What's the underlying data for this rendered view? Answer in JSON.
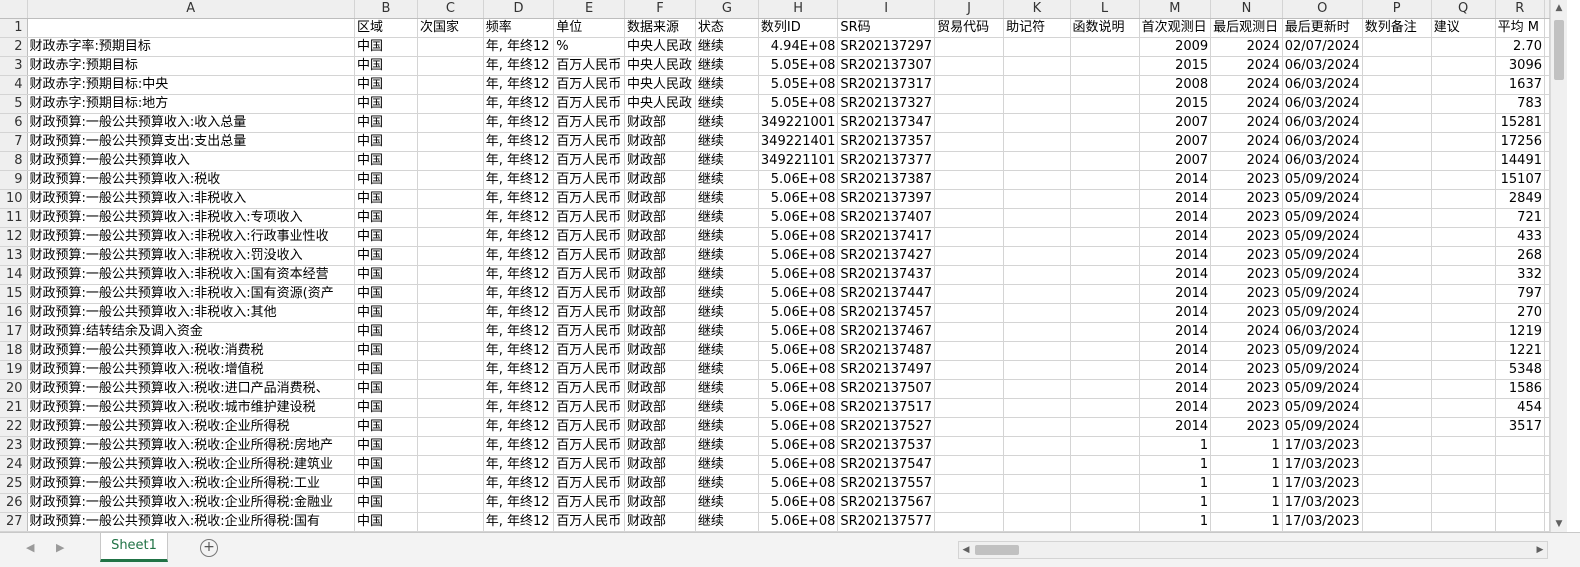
{
  "sheet": {
    "column_letters": [
      "A",
      "B",
      "C",
      "D",
      "E",
      "F",
      "G",
      "H",
      "I",
      "J",
      "K",
      "L",
      "M",
      "N",
      "O",
      "P",
      "Q",
      "R"
    ],
    "header_row_num": "1",
    "headers": [
      "",
      "区域",
      "次国家",
      "频率",
      "单位",
      "数据来源",
      "状态",
      "数列ID",
      "SR码",
      "贸易代码",
      "助记符",
      "函数说明",
      "首次观测日",
      "最后观测日",
      "最后更新时",
      "数列备注",
      "建议",
      "平均 M"
    ],
    "rows": [
      [
        "2",
        "财政赤字率:预期目标",
        "中国",
        "",
        "年, 年终12",
        "%",
        "中央人民政",
        "继续",
        "4.94E+08",
        "SR202137297",
        "",
        "",
        "",
        "2009",
        "2024",
        "02/07/2024",
        "",
        "",
        "2.70"
      ],
      [
        "3",
        "财政赤字:预期目标",
        "中国",
        "",
        "年, 年终12",
        "百万人民币",
        "中央人民政",
        "继续",
        "5.05E+08",
        "SR202137307",
        "",
        "",
        "",
        "2015",
        "2024",
        "06/03/2024",
        "",
        "",
        "3096"
      ],
      [
        "4",
        "财政赤字:预期目标:中央",
        "中国",
        "",
        "年, 年终12",
        "百万人民币",
        "中央人民政",
        "继续",
        "5.05E+08",
        "SR202137317",
        "",
        "",
        "",
        "2008",
        "2024",
        "06/03/2024",
        "",
        "",
        "1637"
      ],
      [
        "5",
        "财政赤字:预期目标:地方",
        "中国",
        "",
        "年, 年终12",
        "百万人民币",
        "中央人民政",
        "继续",
        "5.05E+08",
        "SR202137327",
        "",
        "",
        "",
        "2015",
        "2024",
        "06/03/2024",
        "",
        "",
        "783"
      ],
      [
        "6",
        "财政预算:一般公共预算收入:收入总量",
        "中国",
        "",
        "年, 年终12",
        "百万人民币",
        "财政部",
        "继续",
        "349221001",
        "SR202137347",
        "",
        "",
        "",
        "2007",
        "2024",
        "06/03/2024",
        "",
        "",
        "15281"
      ],
      [
        "7",
        "财政预算:一般公共预算支出:支出总量",
        "中国",
        "",
        "年, 年终12",
        "百万人民币",
        "财政部",
        "继续",
        "349221401",
        "SR202137357",
        "",
        "",
        "",
        "2007",
        "2024",
        "06/03/2024",
        "",
        "",
        "17256"
      ],
      [
        "8",
        "财政预算:一般公共预算收入",
        "中国",
        "",
        "年, 年终12",
        "百万人民币",
        "财政部",
        "继续",
        "349221101",
        "SR202137377",
        "",
        "",
        "",
        "2007",
        "2024",
        "06/03/2024",
        "",
        "",
        "14491"
      ],
      [
        "9",
        "财政预算:一般公共预算收入:税收",
        "中国",
        "",
        "年, 年终12",
        "百万人民币",
        "财政部",
        "继续",
        "5.06E+08",
        "SR202137387",
        "",
        "",
        "",
        "2014",
        "2023",
        "05/09/2024",
        "",
        "",
        "15107"
      ],
      [
        "10",
        "财政预算:一般公共预算收入:非税收入",
        "中国",
        "",
        "年, 年终12",
        "百万人民币",
        "财政部",
        "继续",
        "5.06E+08",
        "SR202137397",
        "",
        "",
        "",
        "2014",
        "2023",
        "05/09/2024",
        "",
        "",
        "2849"
      ],
      [
        "11",
        "财政预算:一般公共预算收入:非税收入:专项收入",
        "中国",
        "",
        "年, 年终12",
        "百万人民币",
        "财政部",
        "继续",
        "5.06E+08",
        "SR202137407",
        "",
        "",
        "",
        "2014",
        "2023",
        "05/09/2024",
        "",
        "",
        "721"
      ],
      [
        "12",
        "财政预算:一般公共预算收入:非税收入:行政事业性收",
        "中国",
        "",
        "年, 年终12",
        "百万人民币",
        "财政部",
        "继续",
        "5.06E+08",
        "SR202137417",
        "",
        "",
        "",
        "2014",
        "2023",
        "05/09/2024",
        "",
        "",
        "433"
      ],
      [
        "13",
        "财政预算:一般公共预算收入:非税收入:罚没收入",
        "中国",
        "",
        "年, 年终12",
        "百万人民币",
        "财政部",
        "继续",
        "5.06E+08",
        "SR202137427",
        "",
        "",
        "",
        "2014",
        "2023",
        "05/09/2024",
        "",
        "",
        "268"
      ],
      [
        "14",
        "财政预算:一般公共预算收入:非税收入:国有资本经营",
        "中国",
        "",
        "年, 年终12",
        "百万人民币",
        "财政部",
        "继续",
        "5.06E+08",
        "SR202137437",
        "",
        "",
        "",
        "2014",
        "2023",
        "05/09/2024",
        "",
        "",
        "332"
      ],
      [
        "15",
        "财政预算:一般公共预算收入:非税收入:国有资源(资产",
        "中国",
        "",
        "年, 年终12",
        "百万人民币",
        "财政部",
        "继续",
        "5.06E+08",
        "SR202137447",
        "",
        "",
        "",
        "2014",
        "2023",
        "05/09/2024",
        "",
        "",
        "797"
      ],
      [
        "16",
        "财政预算:一般公共预算收入:非税收入:其他",
        "中国",
        "",
        "年, 年终12",
        "百万人民币",
        "财政部",
        "继续",
        "5.06E+08",
        "SR202137457",
        "",
        "",
        "",
        "2014",
        "2023",
        "05/09/2024",
        "",
        "",
        "270"
      ],
      [
        "17",
        "财政预算:结转结余及调入资金",
        "中国",
        "",
        "年, 年终12",
        "百万人民币",
        "财政部",
        "继续",
        "5.06E+08",
        "SR202137467",
        "",
        "",
        "",
        "2014",
        "2024",
        "06/03/2024",
        "",
        "",
        "1219"
      ],
      [
        "18",
        "财政预算:一般公共预算收入:税收:消费税",
        "中国",
        "",
        "年, 年终12",
        "百万人民币",
        "财政部",
        "继续",
        "5.06E+08",
        "SR202137487",
        "",
        "",
        "",
        "2014",
        "2023",
        "05/09/2024",
        "",
        "",
        "1221"
      ],
      [
        "19",
        "财政预算:一般公共预算收入:税收:增值税",
        "中国",
        "",
        "年, 年终12",
        "百万人民币",
        "财政部",
        "继续",
        "5.06E+08",
        "SR202137497",
        "",
        "",
        "",
        "2014",
        "2023",
        "05/09/2024",
        "",
        "",
        "5348"
      ],
      [
        "20",
        "财政预算:一般公共预算收入:税收:进口产品消费税、",
        "中国",
        "",
        "年, 年终12",
        "百万人民币",
        "财政部",
        "继续",
        "5.06E+08",
        "SR202137507",
        "",
        "",
        "",
        "2014",
        "2023",
        "05/09/2024",
        "",
        "",
        "1586"
      ],
      [
        "21",
        "财政预算:一般公共预算收入:税收:城市维护建设税",
        "中国",
        "",
        "年, 年终12",
        "百万人民币",
        "财政部",
        "继续",
        "5.06E+08",
        "SR202137517",
        "",
        "",
        "",
        "2014",
        "2023",
        "05/09/2024",
        "",
        "",
        "454"
      ],
      [
        "22",
        "财政预算:一般公共预算收入:税收:企业所得税",
        "中国",
        "",
        "年, 年终12",
        "百万人民币",
        "财政部",
        "继续",
        "5.06E+08",
        "SR202137527",
        "",
        "",
        "",
        "2014",
        "2023",
        "05/09/2024",
        "",
        "",
        "3517"
      ],
      [
        "23",
        "财政预算:一般公共预算收入:税收:企业所得税:房地产",
        "中国",
        "",
        "年, 年终12",
        "百万人民币",
        "财政部",
        "继续",
        "5.06E+08",
        "SR202137537",
        "",
        "",
        "",
        "1",
        "1",
        "17/03/2023",
        "",
        "",
        ""
      ],
      [
        "24",
        "财政预算:一般公共预算收入:税收:企业所得税:建筑业",
        "中国",
        "",
        "年, 年终12",
        "百万人民币",
        "财政部",
        "继续",
        "5.06E+08",
        "SR202137547",
        "",
        "",
        "",
        "1",
        "1",
        "17/03/2023",
        "",
        "",
        ""
      ],
      [
        "25",
        "财政预算:一般公共预算收入:税收:企业所得税:工业",
        "中国",
        "",
        "年, 年终12",
        "百万人民币",
        "财政部",
        "继续",
        "5.06E+08",
        "SR202137557",
        "",
        "",
        "",
        "1",
        "1",
        "17/03/2023",
        "",
        "",
        ""
      ],
      [
        "26",
        "财政预算:一般公共预算收入:税收:企业所得税:金融业",
        "中国",
        "",
        "年, 年终12",
        "百万人民币",
        "财政部",
        "继续",
        "5.06E+08",
        "SR202137567",
        "",
        "",
        "",
        "1",
        "1",
        "17/03/2023",
        "",
        "",
        ""
      ],
      [
        "27",
        "财政预算:一般公共预算收入:税收:企业所得税:国有",
        "中国",
        "",
        "年, 年终12",
        "百万人民币",
        "财政部",
        "继续",
        "5.06E+08",
        "SR202137577",
        "",
        "",
        "",
        "1",
        "1",
        "17/03/2023",
        "",
        "",
        ""
      ]
    ]
  },
  "footer": {
    "sheet_tab_label": "Sheet1",
    "add_sheet_symbol": "⊕"
  }
}
